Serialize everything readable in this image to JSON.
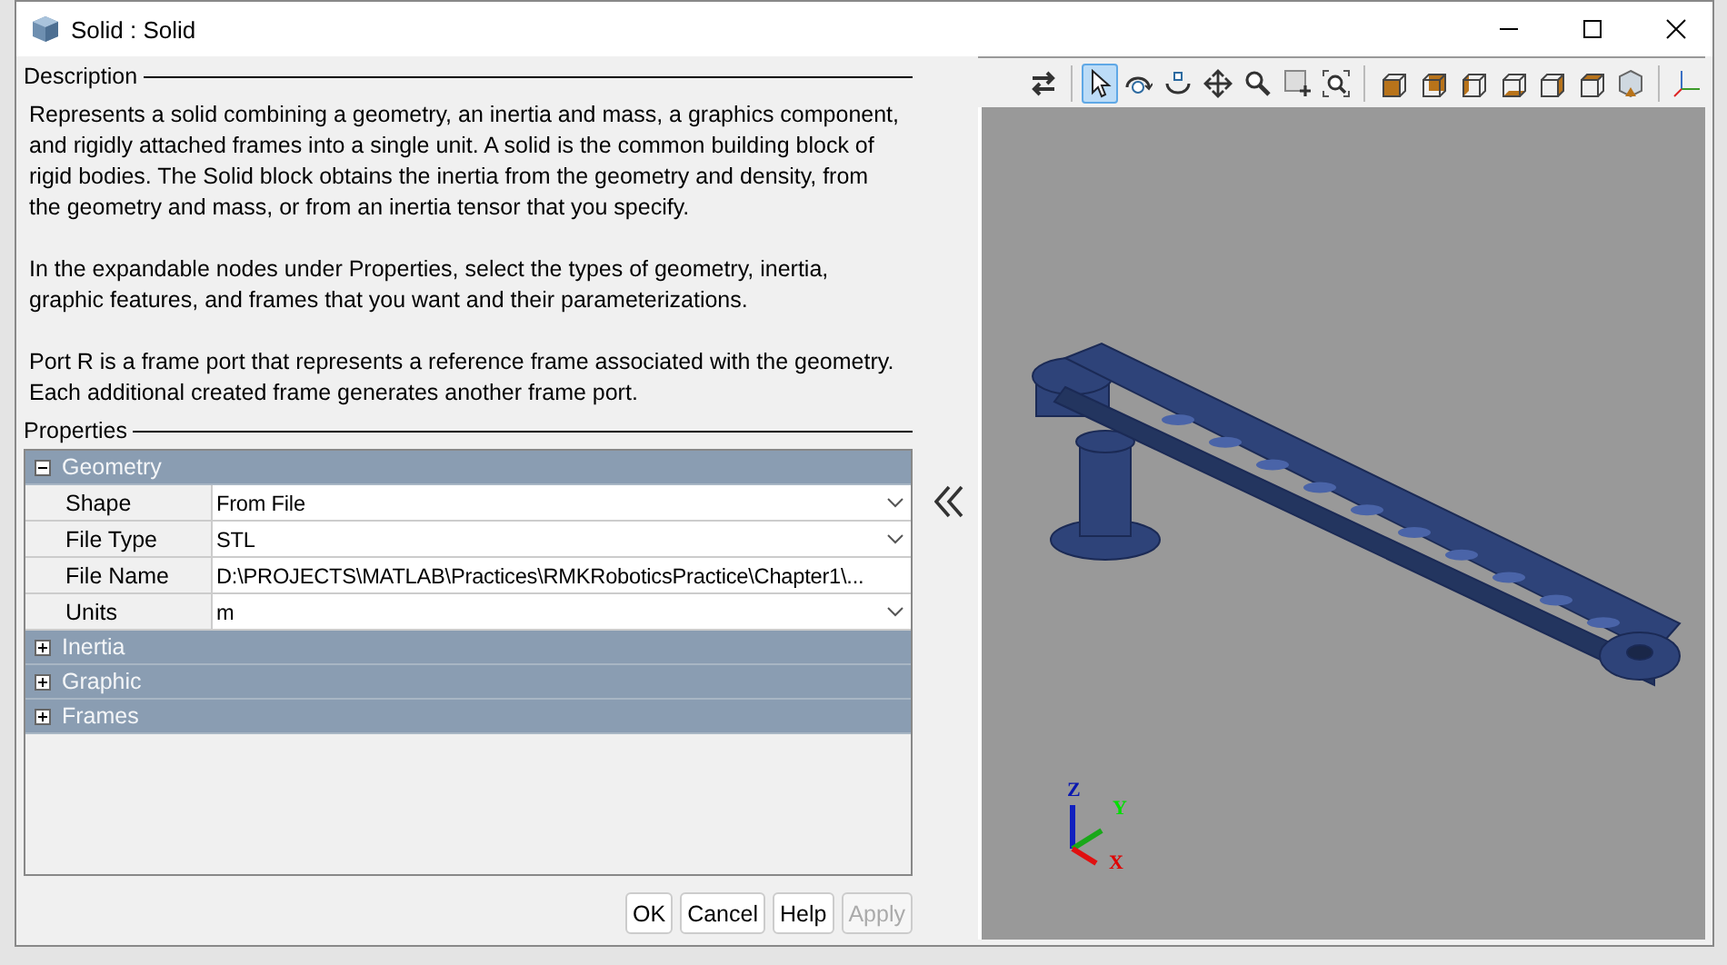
{
  "window": {
    "title": "Solid : Solid"
  },
  "description": {
    "title": "Description",
    "paragraphs": [
      "Represents a solid combining a geometry, an inertia and mass, a graphics component, and rigidly attached frames into a single unit. A solid is the common building block of rigid bodies. The Solid block obtains the inertia from the geometry and density, from the geometry and mass, or from an inertia tensor that you specify.",
      "In the expandable nodes under Properties, select the types of geometry, inertia, graphic features, and frames that you want and their parameterizations.",
      "Port R is a frame port that represents a reference frame associated with the geometry. Each additional created frame generates another frame port."
    ]
  },
  "properties": {
    "title": "Properties",
    "groups": [
      {
        "name": "Geometry",
        "expanded": true,
        "rows": [
          {
            "label": "Shape",
            "value": "From File",
            "kind": "dropdown"
          },
          {
            "label": "File Type",
            "value": "STL",
            "kind": "dropdown"
          },
          {
            "label": "File Name",
            "value": "D:\\PROJECTS\\MATLAB\\Practices\\RMKRoboticsPractice\\Chapter1\\...",
            "kind": "text"
          },
          {
            "label": "Units",
            "value": "m",
            "kind": "dropdown"
          }
        ]
      },
      {
        "name": "Inertia",
        "expanded": false
      },
      {
        "name": "Graphic",
        "expanded": false
      },
      {
        "name": "Frames",
        "expanded": false
      }
    ]
  },
  "buttons": [
    {
      "label": "OK",
      "disabled": false
    },
    {
      "label": "Cancel",
      "disabled": false
    },
    {
      "label": "Help",
      "disabled": false
    },
    {
      "label": "Apply",
      "disabled": true
    }
  ],
  "toolbar": [
    {
      "kind": "swap",
      "selected": false
    },
    {
      "kind": "separator"
    },
    {
      "kind": "select",
      "selected": true
    },
    {
      "kind": "rotate",
      "selected": false
    },
    {
      "kind": "roll",
      "selected": false
    },
    {
      "kind": "pan",
      "selected": false
    },
    {
      "kind": "zoom",
      "selected": false
    },
    {
      "kind": "zoom-box",
      "selected": false
    },
    {
      "kind": "fit",
      "selected": false
    },
    {
      "kind": "separator"
    },
    {
      "kind": "view-front",
      "selected": false
    },
    {
      "kind": "view-back",
      "selected": false
    },
    {
      "kind": "view-left",
      "selected": false
    },
    {
      "kind": "view-bottom",
      "selected": false
    },
    {
      "kind": "view-right",
      "selected": false
    },
    {
      "kind": "view-top",
      "selected": false
    },
    {
      "kind": "view-iso",
      "selected": false
    },
    {
      "kind": "separator"
    },
    {
      "kind": "frames",
      "selected": false
    }
  ],
  "triad": {
    "x": "X",
    "y": "Y",
    "z": "Z"
  }
}
